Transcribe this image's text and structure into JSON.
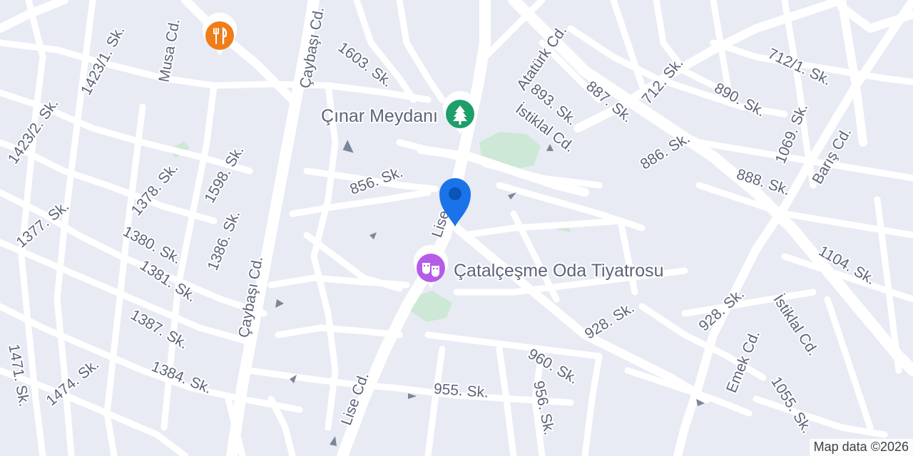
{
  "map": {
    "attribution": "Map data ©2026",
    "streets": {
      "ataturk": "Atatürk Cd.",
      "istiklal_upper": "İstiklal Cd.",
      "istiklal_lower": "İstiklal Cd.",
      "caybasi_upper": "Çaybaşı Cd.",
      "caybasi_lower": "Çaybaşı Cd.",
      "musa": "Musa Cd.",
      "lise_upper": "Lise Cd.",
      "lise_lower": "Lise Cd.",
      "baris": "Barış Cd.",
      "emek": "Emek Cd.",
      "s1423_1": "1423/1. Sk.",
      "s1423_2": "1423/2. Sk.",
      "s1603": "1603. Sk.",
      "s893": "893. Sk.",
      "s887": "887. Sk.",
      "s712": "712. Sk.",
      "s712_1": "712/1. Sk.",
      "s890": "890. Sk.",
      "s1069": "1069. Sk.",
      "s886": "886. Sk.",
      "s888": "888. Sk.",
      "s856": "856. Sk.",
      "s1378": "1378. Sk.",
      "s1598": "1598. Sk.",
      "s1377": "1377. Sk.",
      "s1380": "1380. Sk.",
      "s1386": "1386. Sk.",
      "s1381": "1381. Sk.",
      "s1104": "1104. Sk.",
      "s928a": "928. Sk.",
      "s928b": "928. Sk.",
      "s1387": "1387. Sk.",
      "s960": "960. Sk.",
      "s1471": "1471. Sk.",
      "s1474": "1474. Sk.",
      "s1384": "1384. Sk.",
      "s955": "955. Sk.",
      "s956": "956. Sk.",
      "s1055": "1055. Sk."
    },
    "pois": {
      "park": {
        "label": "Çınar Meydanı",
        "icon": "tree-icon",
        "color": "#1e9e6a"
      },
      "theatre": {
        "label": "Çatalçeşme Oda Tiyatrosu",
        "icon": "theater-masks-icon",
        "color": "#b45be8"
      },
      "restaurant": {
        "label": "",
        "icon": "fork-knife-icon",
        "color": "#f07d1a"
      }
    },
    "marker": {
      "icon": "location-pin-icon",
      "color": "#1a73e8"
    }
  }
}
